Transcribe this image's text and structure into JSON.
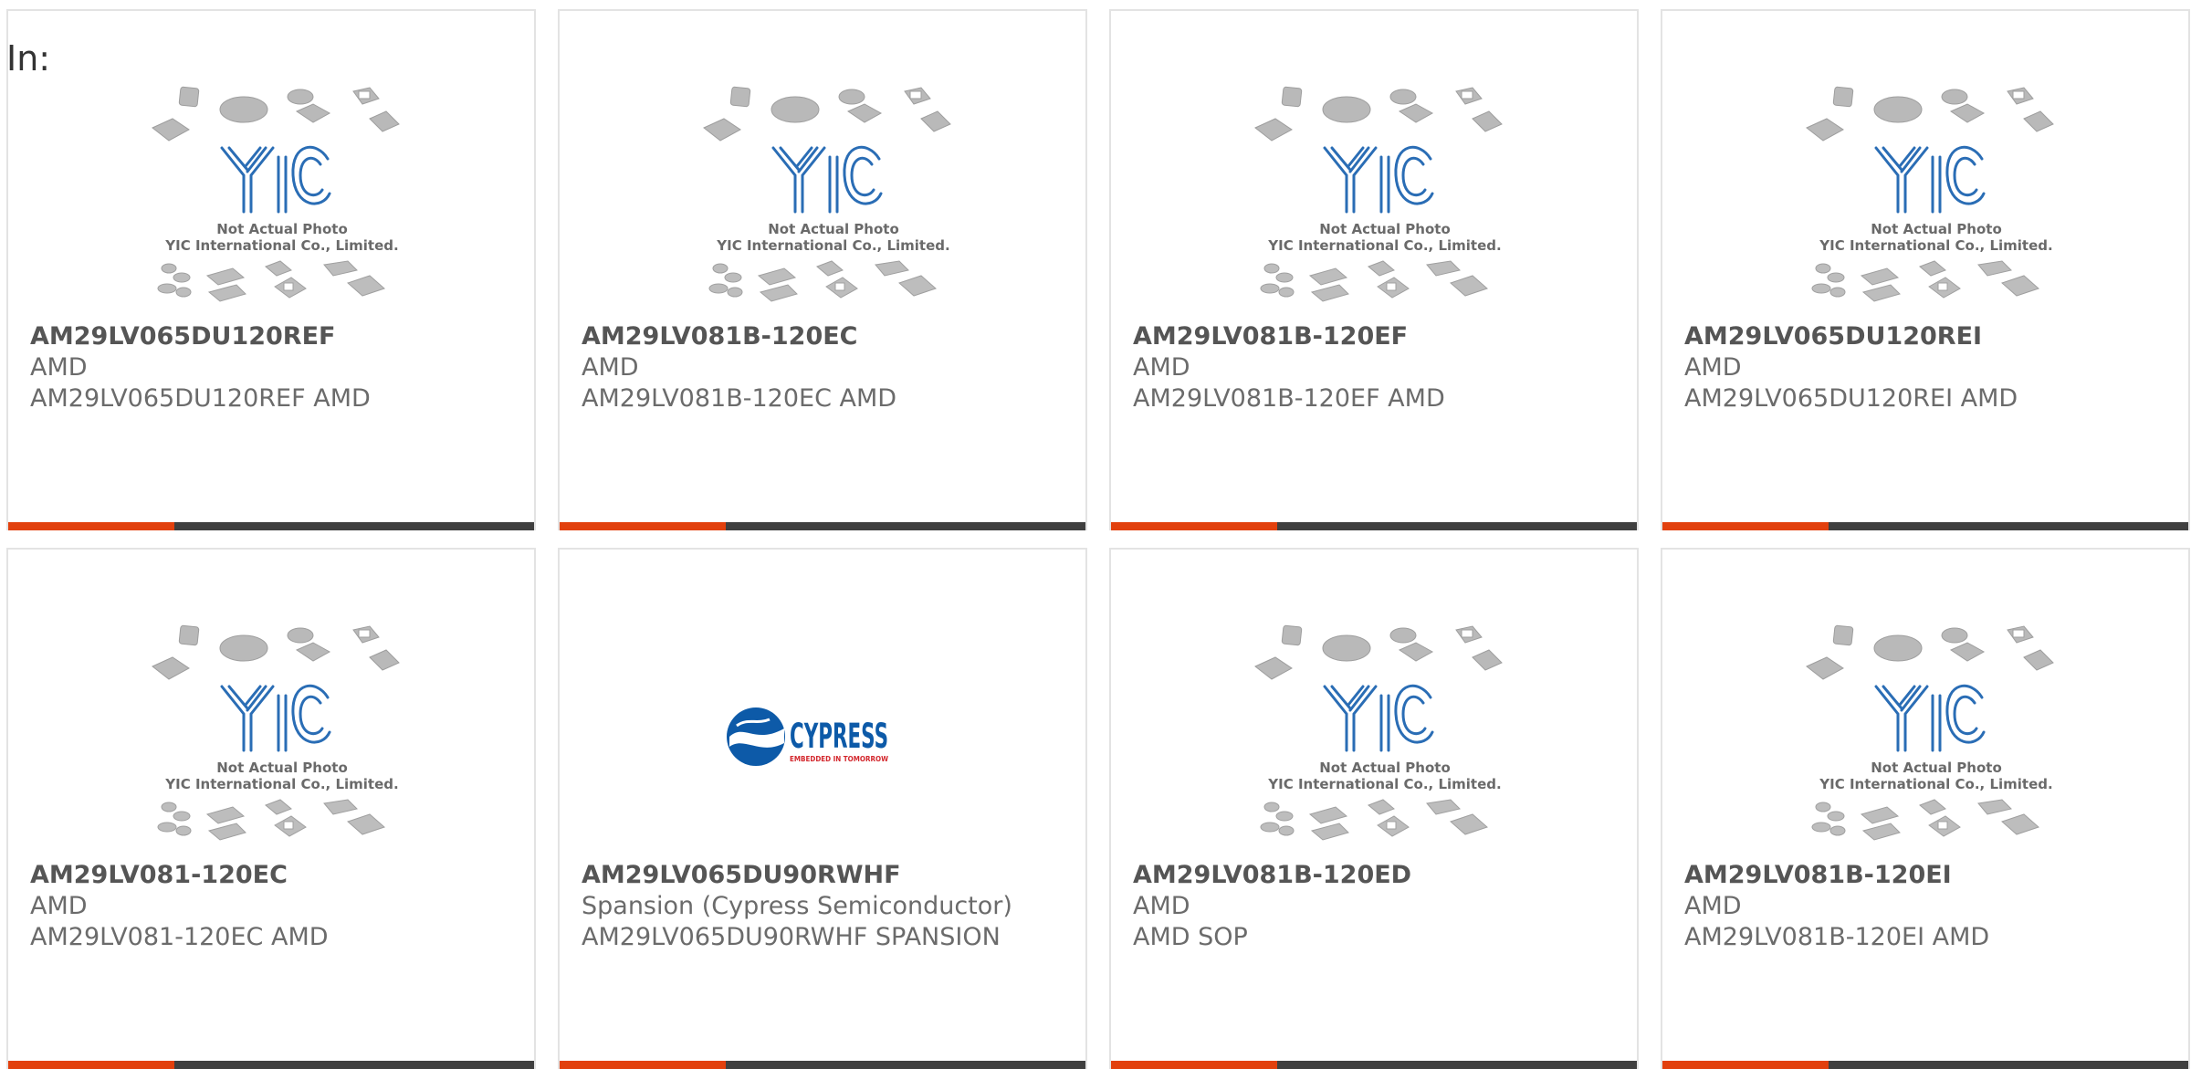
{
  "header": {
    "in_label": "In:"
  },
  "placeholder": {
    "line1": "Not Actual Photo",
    "line2": "YIC International Co., Limited.",
    "logo_text": "YIC"
  },
  "cypress_logo": {
    "name": "CYPRESS",
    "tagline": "EMBEDDED IN TOMORROW"
  },
  "colors": {
    "accent": "#e2400d",
    "bar": "#3f3f3f",
    "logo_blue": "#2a6db5",
    "cypress_blue": "#0d5aa8",
    "cypress_red": "#d3262c"
  },
  "products": [
    {
      "part": "AM29LV065DU120REF",
      "maker": "AMD",
      "desc": "AM29LV065DU120REF AMD",
      "image": "yic-placeholder"
    },
    {
      "part": "AM29LV081B-120EC",
      "maker": "AMD",
      "desc": "AM29LV081B-120EC AMD",
      "image": "yic-placeholder"
    },
    {
      "part": "AM29LV081B-120EF",
      "maker": "AMD",
      "desc": "AM29LV081B-120EF AMD",
      "image": "yic-placeholder"
    },
    {
      "part": "AM29LV065DU120REI",
      "maker": "AMD",
      "desc": "AM29LV065DU120REI AMD",
      "image": "yic-placeholder"
    },
    {
      "part": "AM29LV081-120EC",
      "maker": "AMD",
      "desc": "AM29LV081-120EC AMD",
      "image": "yic-placeholder"
    },
    {
      "part": "AM29LV065DU90RWHF",
      "maker": "Spansion (Cypress Semiconductor)",
      "desc": "AM29LV065DU90RWHF SPANSION",
      "image": "cypress-logo"
    },
    {
      "part": "AM29LV081B-120ED",
      "maker": "AMD",
      "desc": "AMD SOP",
      "image": "yic-placeholder"
    },
    {
      "part": "AM29LV081B-120EI",
      "maker": "AMD",
      "desc": "AM29LV081B-120EI AMD",
      "image": "yic-placeholder"
    }
  ]
}
